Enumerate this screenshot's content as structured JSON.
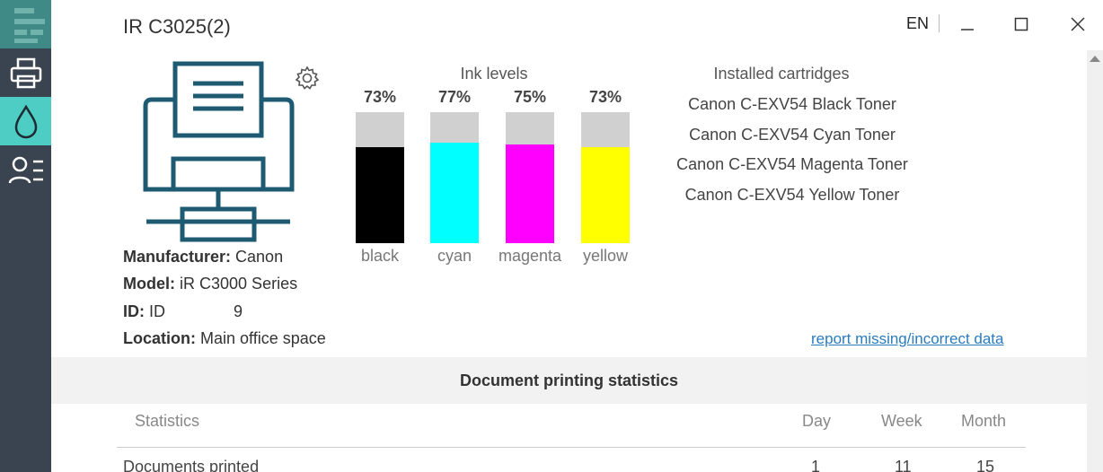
{
  "window": {
    "title": "IR C3025(2)",
    "language": "EN"
  },
  "sidebar": {
    "items": [
      {
        "name": "app-logo-icon"
      },
      {
        "name": "printer-icon"
      },
      {
        "name": "ink-drop-icon"
      },
      {
        "name": "users-list-icon"
      }
    ]
  },
  "printer": {
    "manufacturer_label": "Manufacturer:",
    "manufacturer": "Canon",
    "model_label": "Model:",
    "model": "iR C3000 Series",
    "id_label": "ID:",
    "id_prefix": "ID",
    "id_suffix": "9",
    "location_label": "Location:",
    "location": "Main office space"
  },
  "ink": {
    "title": "Ink levels",
    "levels": [
      {
        "name": "black",
        "percent_label": "73%",
        "level": 0.73,
        "color": "#000000"
      },
      {
        "name": "cyan",
        "percent_label": "77%",
        "level": 0.77,
        "color": "#00ffff"
      },
      {
        "name": "magenta",
        "percent_label": "75%",
        "level": 0.75,
        "color": "#ff00ff"
      },
      {
        "name": "yellow",
        "percent_label": "73%",
        "level": 0.73,
        "color": "#ffff00"
      }
    ]
  },
  "cartridges": {
    "title": "Installed cartridges",
    "items": [
      "Canon C-EXV54 Black Toner",
      "Canon C-EXV54 Cyan Toner",
      "Canon C-EXV54 Magenta Toner",
      "Canon C-EXV54 Yellow Toner"
    ]
  },
  "report_link": "report missing/incorrect data",
  "statistics": {
    "header": "Document printing statistics",
    "columns": [
      "Statistics",
      "Day",
      "Week",
      "Month"
    ],
    "rows": [
      {
        "label": "Documents printed",
        "day": "1",
        "week": "11",
        "month": "15"
      }
    ]
  },
  "colors": {
    "sidebar_bg": "#3a4450",
    "sidebar_active": "#4ecdc4",
    "printer_icon": "#1e5b73",
    "link": "#2a7bbf"
  }
}
